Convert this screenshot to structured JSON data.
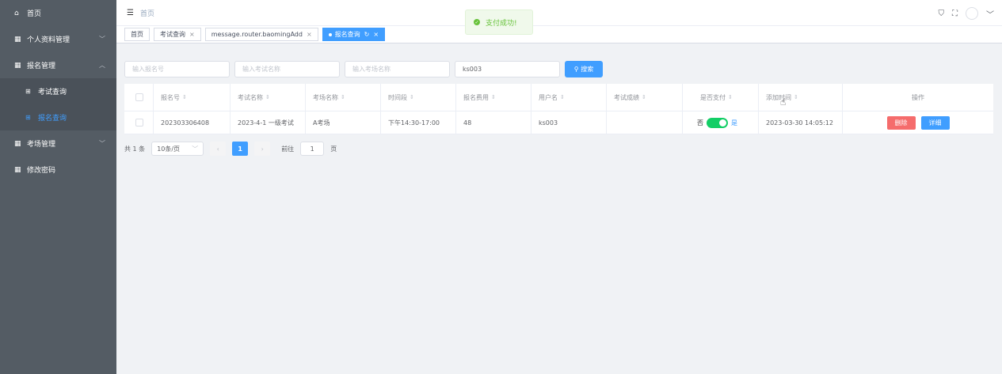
{
  "sidebar": {
    "items": [
      {
        "icon": "home-icon",
        "label": "首页"
      },
      {
        "icon": "grid-icon",
        "label": "个人资料管理"
      },
      {
        "icon": "grid-icon",
        "label": "报名管理"
      },
      {
        "icon": "grid-icon",
        "label": "考场管理"
      },
      {
        "icon": "grid-icon",
        "label": "修改密码"
      }
    ],
    "sub_items": [
      {
        "label": "考试查询"
      },
      {
        "label": "报名查询"
      }
    ]
  },
  "navbar": {
    "breadcrumb": "首页"
  },
  "toast": {
    "message": "支付成功!"
  },
  "tags": [
    {
      "label": "首页"
    },
    {
      "label": "考试查询"
    },
    {
      "label": "message.router.baomingAdd"
    },
    {
      "label": "报名查询"
    }
  ],
  "search": {
    "placeholders": [
      "输入报名号",
      "输入考试名称",
      "输入考场名称"
    ],
    "username_value": "ks003",
    "button_label": "搜索"
  },
  "table": {
    "columns": [
      "报名号",
      "考试名称",
      "考场名称",
      "时间段",
      "报名费用",
      "用户名",
      "考试成绩",
      "是否支付",
      "添加时间",
      "操作"
    ],
    "rows": [
      {
        "enroll_no": "202303306408",
        "exam_name": "2023-4-1 一级考试",
        "room_name": "A考场",
        "time_slot": "下午14:30-17:00",
        "fee": "48",
        "username": "ks003",
        "score": "",
        "paid_off": "否",
        "paid_on": "是",
        "added_time": "2023-03-30 14:05:12",
        "delete_label": "删除",
        "detail_label": "详细"
      }
    ]
  },
  "pagination": {
    "total": "共 1 条",
    "page_size": "10条/页",
    "current_page": "1",
    "goto_label": "前往",
    "goto_value": "1",
    "page_suffix": "页"
  },
  "colors": {
    "sidebar_bg": "#545c64",
    "primary": "#409eff",
    "danger": "#f56c6c",
    "success": "#13ce66"
  }
}
